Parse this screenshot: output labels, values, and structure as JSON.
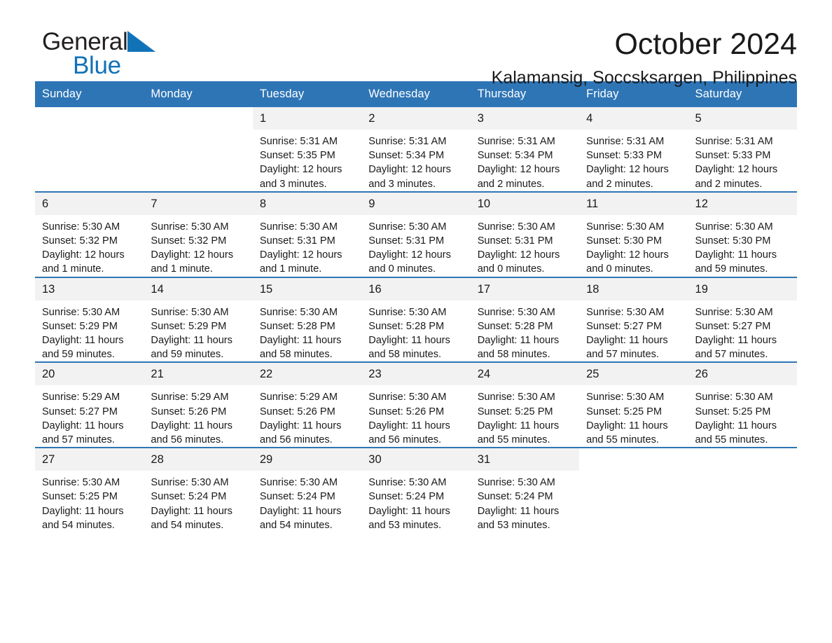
{
  "brand": {
    "name_part1": "General",
    "name_part2": "Blue",
    "triangle_color": "#1272b8",
    "blue": "#1272b8"
  },
  "header": {
    "month_title": "October 2024",
    "location": "Kalamansig, Soccsksargen, Philippines"
  },
  "theme": {
    "header_bar": "#2e75b6",
    "daynum_band": "#f2f2f2",
    "text": "#1a1a1a",
    "page_bg": "#ffffff"
  },
  "calendar": {
    "weekday_headers": [
      "Sunday",
      "Monday",
      "Tuesday",
      "Wednesday",
      "Thursday",
      "Friday",
      "Saturday"
    ],
    "weeks": [
      [
        {
          "day": "",
          "blank": true
        },
        {
          "day": "",
          "blank": true
        },
        {
          "day": "1",
          "sunrise": "Sunrise: 5:31 AM",
          "sunset": "Sunset: 5:35 PM",
          "daylight": "Daylight: 12 hours and 3 minutes."
        },
        {
          "day": "2",
          "sunrise": "Sunrise: 5:31 AM",
          "sunset": "Sunset: 5:34 PM",
          "daylight": "Daylight: 12 hours and 3 minutes."
        },
        {
          "day": "3",
          "sunrise": "Sunrise: 5:31 AM",
          "sunset": "Sunset: 5:34 PM",
          "daylight": "Daylight: 12 hours and 2 minutes."
        },
        {
          "day": "4",
          "sunrise": "Sunrise: 5:31 AM",
          "sunset": "Sunset: 5:33 PM",
          "daylight": "Daylight: 12 hours and 2 minutes."
        },
        {
          "day": "5",
          "sunrise": "Sunrise: 5:31 AM",
          "sunset": "Sunset: 5:33 PM",
          "daylight": "Daylight: 12 hours and 2 minutes."
        }
      ],
      [
        {
          "day": "6",
          "sunrise": "Sunrise: 5:30 AM",
          "sunset": "Sunset: 5:32 PM",
          "daylight": "Daylight: 12 hours and 1 minute."
        },
        {
          "day": "7",
          "sunrise": "Sunrise: 5:30 AM",
          "sunset": "Sunset: 5:32 PM",
          "daylight": "Daylight: 12 hours and 1 minute."
        },
        {
          "day": "8",
          "sunrise": "Sunrise: 5:30 AM",
          "sunset": "Sunset: 5:31 PM",
          "daylight": "Daylight: 12 hours and 1 minute."
        },
        {
          "day": "9",
          "sunrise": "Sunrise: 5:30 AM",
          "sunset": "Sunset: 5:31 PM",
          "daylight": "Daylight: 12 hours and 0 minutes."
        },
        {
          "day": "10",
          "sunrise": "Sunrise: 5:30 AM",
          "sunset": "Sunset: 5:31 PM",
          "daylight": "Daylight: 12 hours and 0 minutes."
        },
        {
          "day": "11",
          "sunrise": "Sunrise: 5:30 AM",
          "sunset": "Sunset: 5:30 PM",
          "daylight": "Daylight: 12 hours and 0 minutes."
        },
        {
          "day": "12",
          "sunrise": "Sunrise: 5:30 AM",
          "sunset": "Sunset: 5:30 PM",
          "daylight": "Daylight: 11 hours and 59 minutes."
        }
      ],
      [
        {
          "day": "13",
          "sunrise": "Sunrise: 5:30 AM",
          "sunset": "Sunset: 5:29 PM",
          "daylight": "Daylight: 11 hours and 59 minutes."
        },
        {
          "day": "14",
          "sunrise": "Sunrise: 5:30 AM",
          "sunset": "Sunset: 5:29 PM",
          "daylight": "Daylight: 11 hours and 59 minutes."
        },
        {
          "day": "15",
          "sunrise": "Sunrise: 5:30 AM",
          "sunset": "Sunset: 5:28 PM",
          "daylight": "Daylight: 11 hours and 58 minutes."
        },
        {
          "day": "16",
          "sunrise": "Sunrise: 5:30 AM",
          "sunset": "Sunset: 5:28 PM",
          "daylight": "Daylight: 11 hours and 58 minutes."
        },
        {
          "day": "17",
          "sunrise": "Sunrise: 5:30 AM",
          "sunset": "Sunset: 5:28 PM",
          "daylight": "Daylight: 11 hours and 58 minutes."
        },
        {
          "day": "18",
          "sunrise": "Sunrise: 5:30 AM",
          "sunset": "Sunset: 5:27 PM",
          "daylight": "Daylight: 11 hours and 57 minutes."
        },
        {
          "day": "19",
          "sunrise": "Sunrise: 5:30 AM",
          "sunset": "Sunset: 5:27 PM",
          "daylight": "Daylight: 11 hours and 57 minutes."
        }
      ],
      [
        {
          "day": "20",
          "sunrise": "Sunrise: 5:29 AM",
          "sunset": "Sunset: 5:27 PM",
          "daylight": "Daylight: 11 hours and 57 minutes."
        },
        {
          "day": "21",
          "sunrise": "Sunrise: 5:29 AM",
          "sunset": "Sunset: 5:26 PM",
          "daylight": "Daylight: 11 hours and 56 minutes."
        },
        {
          "day": "22",
          "sunrise": "Sunrise: 5:29 AM",
          "sunset": "Sunset: 5:26 PM",
          "daylight": "Daylight: 11 hours and 56 minutes."
        },
        {
          "day": "23",
          "sunrise": "Sunrise: 5:30 AM",
          "sunset": "Sunset: 5:26 PM",
          "daylight": "Daylight: 11 hours and 56 minutes."
        },
        {
          "day": "24",
          "sunrise": "Sunrise: 5:30 AM",
          "sunset": "Sunset: 5:25 PM",
          "daylight": "Daylight: 11 hours and 55 minutes."
        },
        {
          "day": "25",
          "sunrise": "Sunrise: 5:30 AM",
          "sunset": "Sunset: 5:25 PM",
          "daylight": "Daylight: 11 hours and 55 minutes."
        },
        {
          "day": "26",
          "sunrise": "Sunrise: 5:30 AM",
          "sunset": "Sunset: 5:25 PM",
          "daylight": "Daylight: 11 hours and 55 minutes."
        }
      ],
      [
        {
          "day": "27",
          "sunrise": "Sunrise: 5:30 AM",
          "sunset": "Sunset: 5:25 PM",
          "daylight": "Daylight: 11 hours and 54 minutes."
        },
        {
          "day": "28",
          "sunrise": "Sunrise: 5:30 AM",
          "sunset": "Sunset: 5:24 PM",
          "daylight": "Daylight: 11 hours and 54 minutes."
        },
        {
          "day": "29",
          "sunrise": "Sunrise: 5:30 AM",
          "sunset": "Sunset: 5:24 PM",
          "daylight": "Daylight: 11 hours and 54 minutes."
        },
        {
          "day": "30",
          "sunrise": "Sunrise: 5:30 AM",
          "sunset": "Sunset: 5:24 PM",
          "daylight": "Daylight: 11 hours and 53 minutes."
        },
        {
          "day": "31",
          "sunrise": "Sunrise: 5:30 AM",
          "sunset": "Sunset: 5:24 PM",
          "daylight": "Daylight: 11 hours and 53 minutes."
        },
        {
          "day": "",
          "blank": true
        },
        {
          "day": "",
          "blank": true
        }
      ]
    ]
  }
}
